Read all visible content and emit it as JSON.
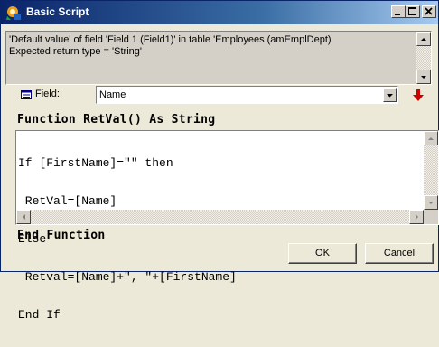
{
  "window": {
    "title": "Basic Script",
    "icon": "app-icon",
    "controls": {
      "minimize": "minimize-icon",
      "maximize": "maximize-icon",
      "close": "close-icon"
    }
  },
  "description": {
    "line1": "'Default value' of field 'Field 1 (Field1)' in table 'Employees (amEmplDept)'",
    "line2": "Expected return type = 'String'"
  },
  "field": {
    "label_accel": "F",
    "label_rest": "ield:",
    "value": "Name",
    "insert_icon": "red-down-arrow-icon"
  },
  "code": {
    "header": "Function RetVal() As String",
    "lines": [
      "If [FirstName]=\"\" then",
      " RetVal=[Name]",
      "Else",
      " Retval=[Name]+\", \"+[FirstName]",
      "End If"
    ],
    "footer": "End Function"
  },
  "buttons": {
    "ok": "OK",
    "cancel": "Cancel"
  },
  "colors": {
    "titlebar_start": "#0a246a",
    "titlebar_end": "#a6caf0",
    "face": "#ece9d8",
    "arrow_red": "#cc0000"
  }
}
